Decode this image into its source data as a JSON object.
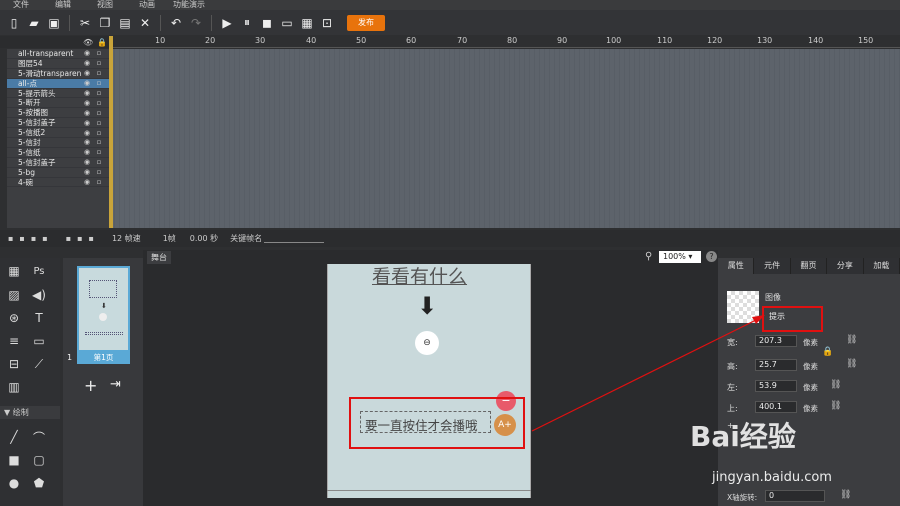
{
  "menu": [
    "文件",
    "编辑",
    "视图",
    "动画",
    "功能演示"
  ],
  "toolbar": {
    "publish_label": "发布"
  },
  "ruler": [
    "10",
    "20",
    "30",
    "40",
    "50",
    "60",
    "70",
    "80",
    "90",
    "100",
    "110",
    "120",
    "130",
    "140",
    "150"
  ],
  "layers": [
    {
      "name": "all-transparent"
    },
    {
      "name": "图层54"
    },
    {
      "name": "5-滑动transparen"
    },
    {
      "name": "all-点"
    },
    {
      "name": "5-提示箭头"
    },
    {
      "name": "5-断开"
    },
    {
      "name": "5-按播图"
    },
    {
      "name": "5-信封盖子"
    },
    {
      "name": "5-信纸2"
    },
    {
      "name": "5-信封"
    },
    {
      "name": "5-信纸"
    },
    {
      "name": "5-信封盖子"
    },
    {
      "name": "5-bg"
    },
    {
      "name": "4-碗"
    }
  ],
  "timeline_footer": {
    "fps": "12 帧速",
    "frame": "1帧",
    "time": "0.00 秒",
    "keyframe": "关键帧名"
  },
  "pages": {
    "thumb_label": "第1页",
    "page_number": "1"
  },
  "stage": {
    "tab": "舞台",
    "zoom": "100%",
    "title": "看看有什么",
    "caption": "要一直按住才会播哦"
  },
  "props": {
    "tabs": [
      "属性",
      "元件",
      "翻页",
      "分享",
      "加载"
    ],
    "type_label": "图像",
    "name_value": "提示",
    "width_label": "宽:",
    "width": "207.3",
    "height_label": "高:",
    "height": "25.7",
    "left_label": "左:",
    "left": "53.9",
    "top_label": "上:",
    "top": "400.1",
    "unit": "像素",
    "x_rot_label": "X轴旋转:",
    "x_rot": "0"
  },
  "watermark": {
    "logo": "Bai经验",
    "url": "jingyan.baidu.com"
  }
}
